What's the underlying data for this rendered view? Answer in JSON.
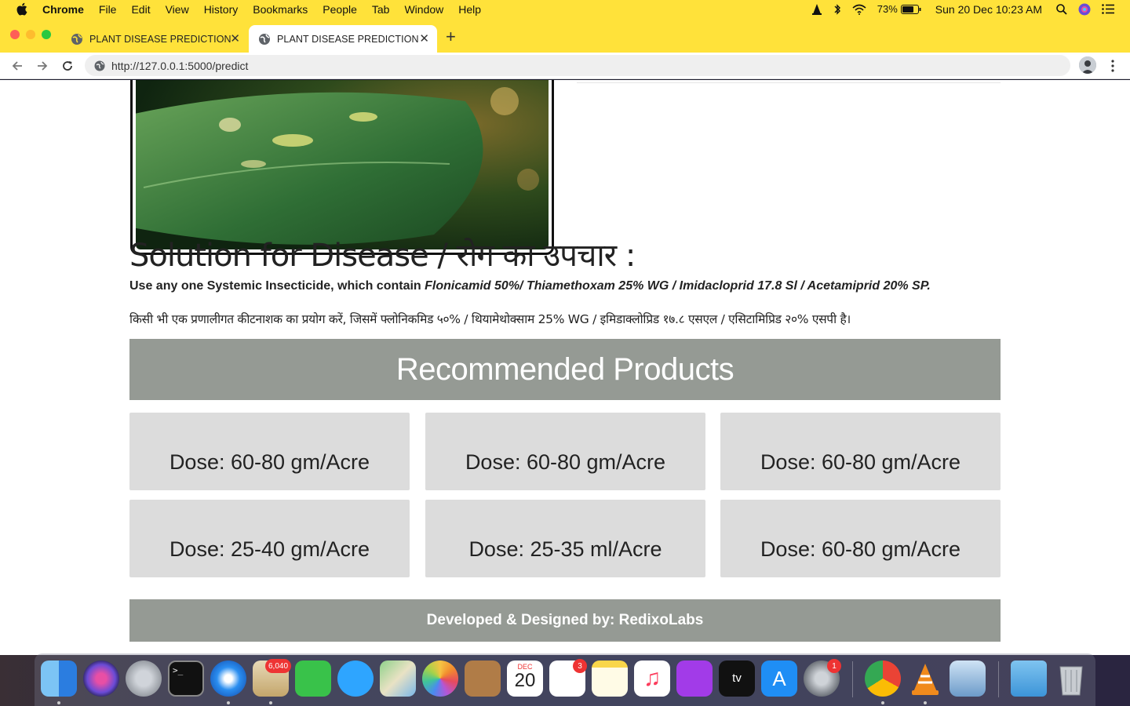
{
  "menubar": {
    "app": "Chrome",
    "items": [
      "File",
      "Edit",
      "View",
      "History",
      "Bookmarks",
      "People",
      "Tab",
      "Window",
      "Help"
    ],
    "battery": "73%",
    "datetime": "Sun 20 Dec  10:23 AM"
  },
  "tabs": [
    {
      "label": "PLANT DISEASE PREDICTION",
      "active": false
    },
    {
      "label": "PLANT DISEASE PREDICTION",
      "active": true
    }
  ],
  "address": {
    "url": "http://127.0.0.1:5000/predict"
  },
  "page": {
    "solution_title": "Solution for Disease / रोग का उपचार :",
    "solution_en_prefix": "Use any one Systemic Insecticide, which contain ",
    "solution_en_chemicals": "Flonicamid 50%/ Thiamethoxam 25% WG / Imidacloprid 17.8 Sl / Acetamiprid 20% SP.",
    "solution_hi": "किसी भी एक प्रणालीगत कीटनाशक का प्रयोग करें, जिसमें फ्लोनिकमिड ५०% / थियामेथोक्साम 25% WG / इमिडाक्लोप्रिड १७.८ एसएल / एसिटामिप्रिड २०% एसपी है।",
    "recommended_title": "Recommended Products",
    "products": [
      {
        "dose": "Dose: 60-80 gm/Acre"
      },
      {
        "dose": "Dose: 60-80 gm/Acre"
      },
      {
        "dose": "Dose: 60-80 gm/Acre"
      },
      {
        "dose": "Dose: 25-40 gm/Acre"
      },
      {
        "dose": "Dose: 25-35 ml/Acre"
      },
      {
        "dose": "Dose: 60-80 gm/Acre"
      }
    ],
    "footer": "Developed & Designed by: RedixoLabs"
  },
  "dock": {
    "badges": {
      "mail": "6,040",
      "reminders": "3",
      "system_preferences": "1"
    },
    "calendar_month": "DEC",
    "calendar_day": "20"
  },
  "colors": {
    "chrome_frame": "#ffe23a",
    "banner": "#959a94",
    "card": "#dcdcdc"
  }
}
